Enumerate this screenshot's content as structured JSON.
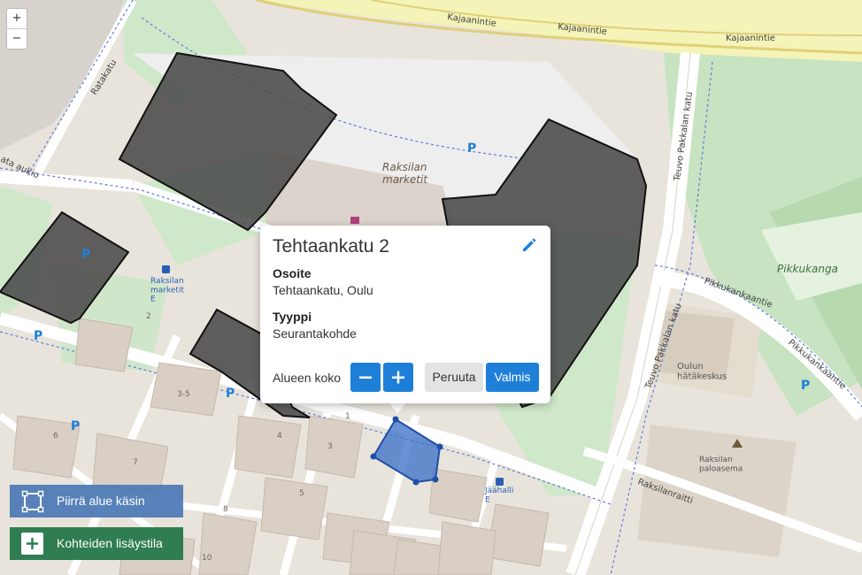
{
  "map": {
    "street_labels": {
      "kajaanintie": "Kajaanintie",
      "ratakatu": "Ratakatu",
      "aukio": "ata aukio",
      "teuvo": "Teuvo Pakkalan katu",
      "pikkukankaantie": "Pikkukankaantie",
      "pikkukanka_area": "Pikkukanga",
      "raksilanraitti": "Raksilanraitti"
    },
    "place_labels": {
      "raksilan_marketit": "Raksilan\nmarketit",
      "raksilan_stop": "Raksilan\nmarketit\nE",
      "jaahalli_stop": "Jäähalli\nE",
      "hatakeskus": "Oulun\nhätäkeskus",
      "paloasema": "Raksilan\npaloasema"
    },
    "parking_symbol": "P",
    "house_numbers": [
      "1",
      "2",
      "3",
      "4",
      "5",
      "6",
      "7",
      "8",
      "10",
      "3-5"
    ]
  },
  "zoom": {
    "in": "+",
    "out": "−"
  },
  "popup": {
    "title": "Tehtaankatu 2",
    "address_label": "Osoite",
    "address_value": "Tehtaankatu, Oulu",
    "type_label": "Tyyppi",
    "type_value": "Seurantakohde",
    "size_label": "Alueen koko",
    "cancel_label": "Peruuta",
    "done_label": "Valmis"
  },
  "tools": {
    "draw_label": "Piirrä alue käsin",
    "add_label": "Kohteiden lisäystila"
  },
  "colors": {
    "accent_blue": "#1e7fd8",
    "selected_area": "#3f72c8",
    "building_overlay": "#4a4a4a",
    "green_area": "#c9e7c5",
    "add_tool": "#2f7d50",
    "draw_tool": "#4a78b4"
  }
}
